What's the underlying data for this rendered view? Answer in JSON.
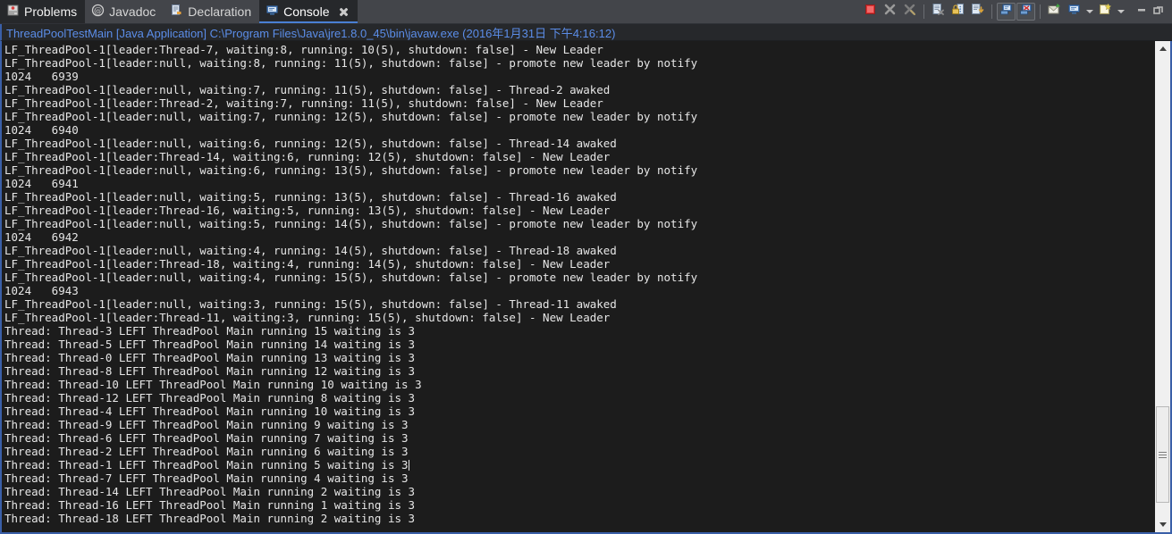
{
  "tabs": [
    {
      "label": "Problems",
      "icon": "problems-icon",
      "state": "selected"
    },
    {
      "label": "Javadoc",
      "icon": "javadoc-icon",
      "state": "normal"
    },
    {
      "label": "Declaration",
      "icon": "declaration-icon",
      "state": "normal"
    },
    {
      "label": "Console",
      "icon": "console-icon",
      "state": "active"
    }
  ],
  "toolbar": {
    "buttons": [
      {
        "name": "terminate-button",
        "tooltip": "Terminate",
        "icon": "red-stop-square-icon",
        "toggled": false
      },
      {
        "name": "remove-launch-button",
        "tooltip": "Remove Launch",
        "icon": "x-icon",
        "toggled": false
      },
      {
        "name": "remove-all-terminated-button",
        "tooltip": "Remove All Terminated Launches",
        "icon": "x-tools-icon",
        "toggled": false
      },
      {
        "name": "clear-console-button",
        "tooltip": "Clear Console",
        "icon": "clear-console-icon",
        "toggled": false
      },
      {
        "name": "scroll-lock-button",
        "tooltip": "Scroll Lock",
        "icon": "padlock-icon",
        "toggled": false
      },
      {
        "name": "word-wrap-button",
        "tooltip": "Word Wrap",
        "icon": "word-wrap-icon",
        "toggled": false
      },
      {
        "name": "show-on-stdout-button",
        "tooltip": "Show Console When Standard Out Changes",
        "icon": "console-out-icon",
        "toggled": true
      },
      {
        "name": "show-on-stderr-button",
        "tooltip": "Show Console When Standard Error Changes",
        "icon": "console-err-icon",
        "toggled": true
      },
      {
        "name": "pin-console-button",
        "tooltip": "Pin Console",
        "icon": "pin-console-icon",
        "toggled": false
      },
      {
        "name": "display-selected-console-button",
        "tooltip": "Display Selected Console",
        "icon": "display-console-icon",
        "toggled": false
      },
      {
        "name": "open-console-button",
        "tooltip": "Open Console",
        "icon": "open-console-icon",
        "toggled": false
      }
    ],
    "window": [
      {
        "name": "minimize-button",
        "icon": "minimize-icon"
      },
      {
        "name": "maximize-button",
        "icon": "maximize-icon"
      }
    ]
  },
  "console": {
    "title": "ThreadPoolTestMain [Java Application] C:\\Program Files\\Java\\jre1.8.0_45\\bin\\javaw.exe (2016年1月31日 下午4:16:12)",
    "lines": [
      "LF_ThreadPool-1[leader:Thread-7, waiting:8, running: 10(5), shutdown: false] - New Leader",
      "LF_ThreadPool-1[leader:null, waiting:8, running: 11(5), shutdown: false] - promote new leader by notify",
      "1024   6939",
      "LF_ThreadPool-1[leader:null, waiting:7, running: 11(5), shutdown: false] - Thread-2 awaked",
      "LF_ThreadPool-1[leader:Thread-2, waiting:7, running: 11(5), shutdown: false] - New Leader",
      "LF_ThreadPool-1[leader:null, waiting:7, running: 12(5), shutdown: false] - promote new leader by notify",
      "1024   6940",
      "LF_ThreadPool-1[leader:null, waiting:6, running: 12(5), shutdown: false] - Thread-14 awaked",
      "LF_ThreadPool-1[leader:Thread-14, waiting:6, running: 12(5), shutdown: false] - New Leader",
      "LF_ThreadPool-1[leader:null, waiting:6, running: 13(5), shutdown: false] - promote new leader by notify",
      "1024   6941",
      "LF_ThreadPool-1[leader:null, waiting:5, running: 13(5), shutdown: false] - Thread-16 awaked",
      "LF_ThreadPool-1[leader:Thread-16, waiting:5, running: 13(5), shutdown: false] - New Leader",
      "LF_ThreadPool-1[leader:null, waiting:5, running: 14(5), shutdown: false] - promote new leader by notify",
      "1024   6942",
      "LF_ThreadPool-1[leader:null, waiting:4, running: 14(5), shutdown: false] - Thread-18 awaked",
      "LF_ThreadPool-1[leader:Thread-18, waiting:4, running: 14(5), shutdown: false] - New Leader",
      "LF_ThreadPool-1[leader:null, waiting:4, running: 15(5), shutdown: false] - promote new leader by notify",
      "1024   6943",
      "LF_ThreadPool-1[leader:null, waiting:3, running: 15(5), shutdown: false] - Thread-11 awaked",
      "LF_ThreadPool-1[leader:Thread-11, waiting:3, running: 15(5), shutdown: false] - New Leader",
      "Thread: Thread-3 LEFT ThreadPool Main running 15 waiting is 3",
      "Thread: Thread-5 LEFT ThreadPool Main running 14 waiting is 3",
      "Thread: Thread-0 LEFT ThreadPool Main running 13 waiting is 3",
      "Thread: Thread-8 LEFT ThreadPool Main running 12 waiting is 3",
      "Thread: Thread-10 LEFT ThreadPool Main running 10 waiting is 3",
      "Thread: Thread-12 LEFT ThreadPool Main running 8 waiting is 3",
      "Thread: Thread-4 LEFT ThreadPool Main running 10 waiting is 3",
      "Thread: Thread-9 LEFT ThreadPool Main running 9 waiting is 3",
      "Thread: Thread-6 LEFT ThreadPool Main running 7 waiting is 3",
      "Thread: Thread-2 LEFT ThreadPool Main running 6 waiting is 3",
      "Thread: Thread-1 LEFT ThreadPool Main running 5 waiting is 3",
      "Thread: Thread-7 LEFT ThreadPool Main running 4 waiting is 3",
      "Thread: Thread-14 LEFT ThreadPool Main running 2 waiting is 3",
      "Thread: Thread-16 LEFT ThreadPool Main running 1 waiting is 3",
      "Thread: Thread-18 LEFT ThreadPool Main running 2 waiting is 3"
    ],
    "caret_line_index": 31
  },
  "colors": {
    "console_background": "#1c1c1c",
    "console_text": "#e6e6e6",
    "console_title_text": "#5b8de8",
    "accent_border": "#3a5fa8",
    "tabbar_background": "#43454a",
    "active_tab_background": "#26282b",
    "stop_red": "#e03535"
  },
  "scrollbar": {
    "name": "console-vertical-scrollbar",
    "thumb_top_percent": 76,
    "thumb_height_percent": 21
  }
}
